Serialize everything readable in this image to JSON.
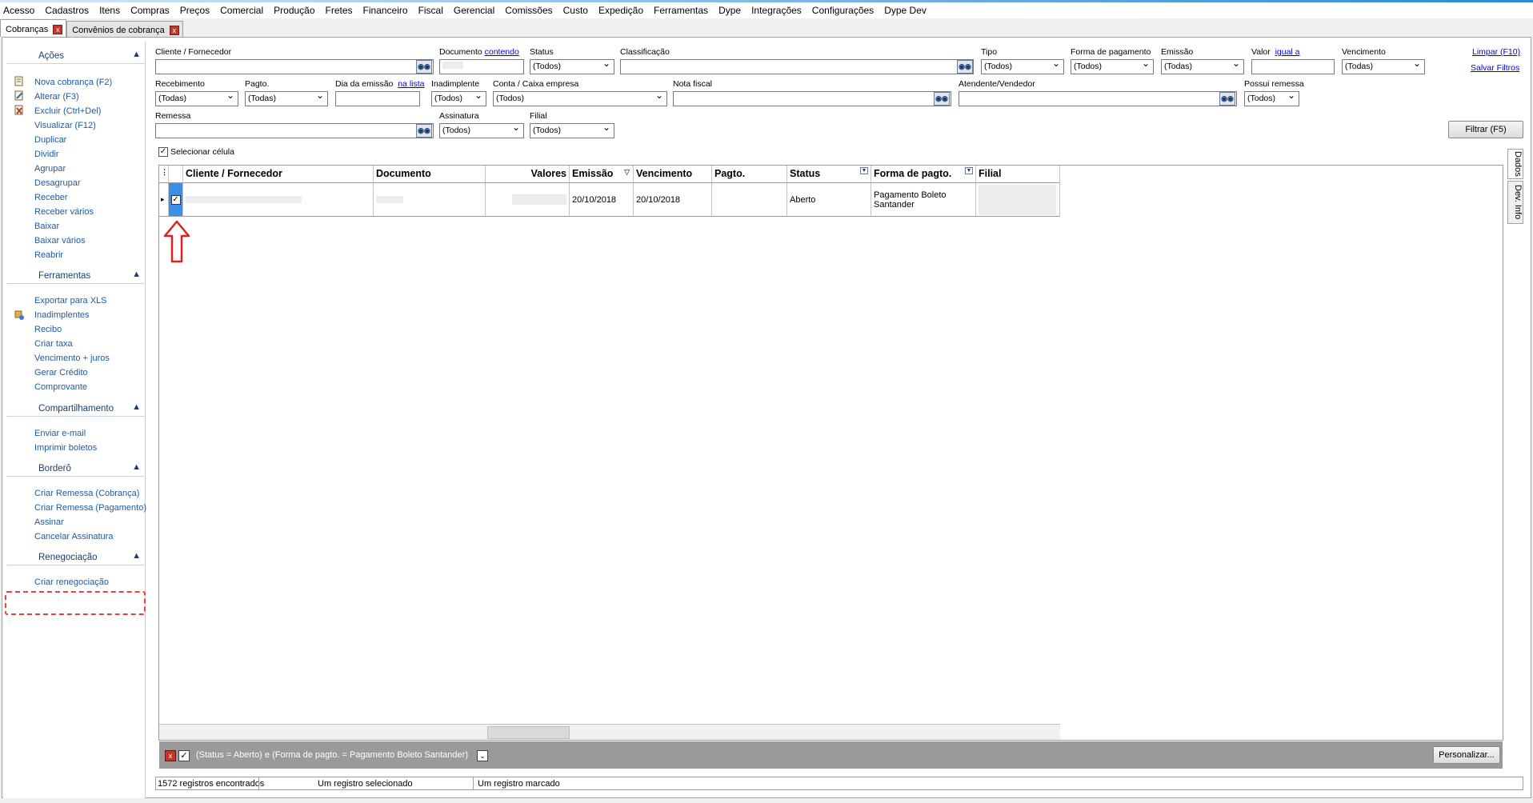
{
  "menu": [
    "Acesso",
    "Cadastros",
    "Itens",
    "Compras",
    "Preços",
    "Comercial",
    "Produção",
    "Fretes",
    "Financeiro",
    "Fiscal",
    "Gerencial",
    "Comissões",
    "Custo",
    "Expedição",
    "Ferramentas",
    "Dype",
    "Integrações",
    "Configurações",
    "Dype Dev"
  ],
  "tabs": [
    {
      "label": "Cobranças",
      "close": "x"
    },
    {
      "label": "Convênios de cobrança",
      "close": "x"
    }
  ],
  "sidebar": {
    "sections": [
      {
        "title": "Ações",
        "items": [
          "Nova cobrança (F2)",
          "Alterar (F3)",
          "Excluir (Ctrl+Del)",
          "Visualizar (F12)",
          "Duplicar",
          "Dividir",
          "Agrupar",
          "Desagrupar",
          "Receber",
          "Receber vários",
          "Baixar",
          "Baixar vários",
          "Reabrir"
        ]
      },
      {
        "title": "Ferramentas",
        "items": [
          "Exportar para XLS",
          "Inadimplentes",
          "Recibo",
          "Criar taxa",
          "Vencimento + juros",
          "Gerar Crédito",
          "Comprovante"
        ]
      },
      {
        "title": "Compartilhamento",
        "items": [
          "Enviar e-mail",
          "Imprimir boletos"
        ]
      },
      {
        "title": "Borderô",
        "items": [
          "Criar Remessa (Cobrança)",
          "Criar Remessa (Pagamento)",
          "Assinar",
          "Cancelar Assinatura"
        ]
      },
      {
        "title": "Renegociação",
        "items": [
          "Criar renegociação"
        ]
      }
    ]
  },
  "filters": {
    "cliente_label": "Cliente / Fornecedor",
    "documento_label": "Documento",
    "documento_link": "contendo",
    "status_label": "Status",
    "status_value": "(Todos)",
    "classificacao_label": "Classificação",
    "tipo_label": "Tipo",
    "tipo_value": "(Todos)",
    "forma_label": "Forma de pagamento",
    "forma_value": "(Todos)",
    "emissao_label": "Emissão",
    "emissao_value": "(Todas)",
    "valor_label": "Valor",
    "valor_link": "igual a",
    "vencimento_label": "Vencimento",
    "vencimento_value": "(Todas)",
    "limpar": "Limpar (F10)",
    "salvar": "Salvar Filtros",
    "recebimento_label": "Recebimento",
    "recebimento_value": "(Todas)",
    "pagto_label": "Pagto.",
    "pagto_value": "(Todas)",
    "dia_emissao_label": "Dia da emissão",
    "dia_emissao_link": "na lista",
    "inadimplente_label": "Inadimplente",
    "inadimplente_value": "(Todos)",
    "conta_label": "Conta / Caixa empresa",
    "conta_value": "(Todos)",
    "nota_label": "Nota fiscal",
    "atendente_label": "Atendente/Vendedor",
    "possui_label": "Possui remessa",
    "possui_value": "(Todos)",
    "remessa_label": "Remessa",
    "assinatura_label": "Assinatura",
    "assinatura_value": "(Todos)",
    "filial_label": "Filial",
    "filial_value": "(Todos)",
    "filtrar": "Filtrar (F5)",
    "selecionar_celula": "Selecionar célula"
  },
  "grid": {
    "columns": [
      "Cliente / Fornecedor",
      "Documento",
      "Valores",
      "Emissão",
      "Vencimento",
      "Pagto.",
      "Status",
      "Forma de pagto.",
      "Filial"
    ],
    "rows": [
      {
        "emissao": "20/10/2018",
        "vencimento": "20/10/2018",
        "pagto": "",
        "status": "Aberto",
        "forma": "Pagamento Boleto Santander"
      }
    ]
  },
  "filter_bar": {
    "text": "(Status = Aberto) e (Forma de pagto. = Pagamento Boleto Santander)",
    "personalizar": "Personalizar..."
  },
  "side_tabs": [
    "Dados",
    "Dev. Info"
  ],
  "status_bar": [
    "1572 registros encontrados",
    "Um registro selecionado",
    "Um registro marcado"
  ]
}
